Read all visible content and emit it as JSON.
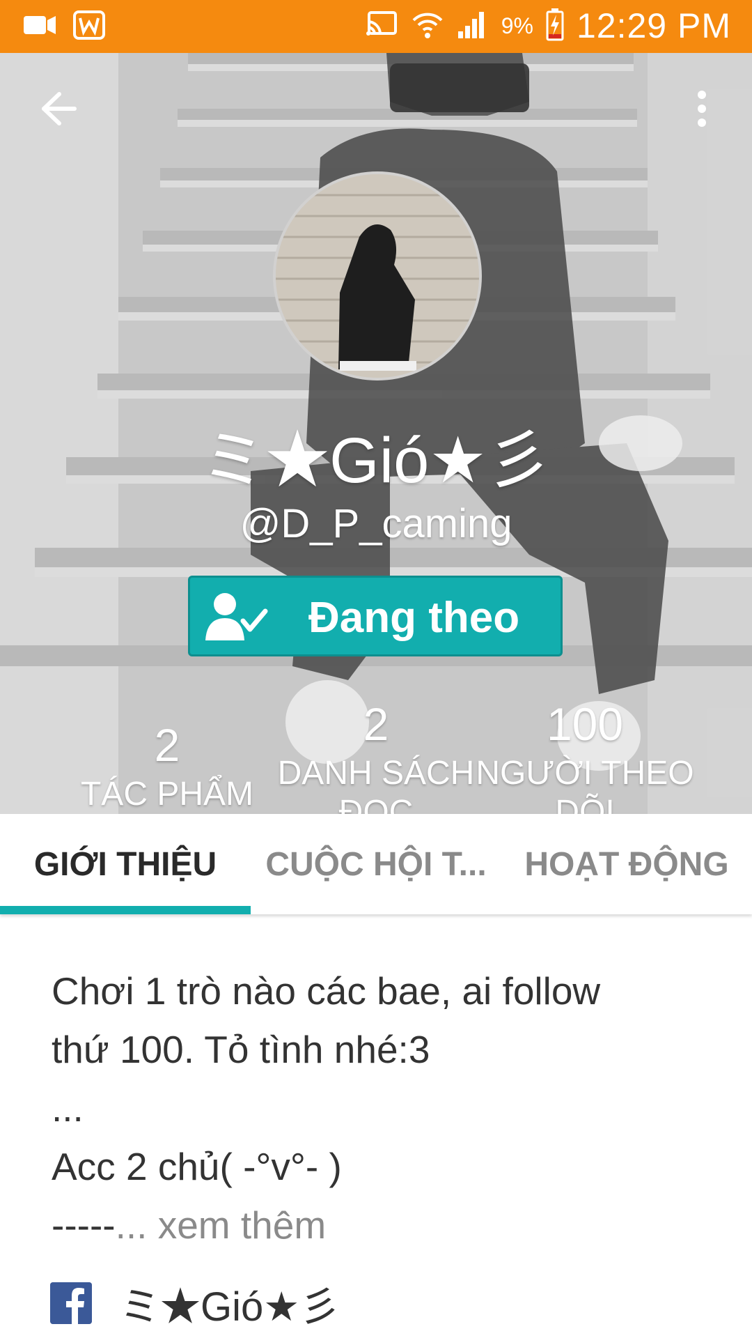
{
  "status_bar": {
    "battery_percent": "9%",
    "time": "12:29 PM",
    "bg_color": "#f58a0f",
    "icons": [
      "video-icon",
      "w-app-icon",
      "cast-icon",
      "wifi-icon",
      "signal-icon",
      "battery-charging-icon"
    ]
  },
  "header": {
    "back_icon": "arrow-left-icon",
    "menu_icon": "more-vertical-icon"
  },
  "profile": {
    "display_name": "ミ★Gió★彡",
    "username": "@D_P_caming",
    "follow_button_label": "Đang theo dõi",
    "follow_button_color": "#12aeae"
  },
  "stats": [
    {
      "value": "2",
      "label": "TÁC PHẨM"
    },
    {
      "value": "2",
      "label": "DANH SÁCH ĐỌC"
    },
    {
      "value": "100",
      "label": "NGƯỜI THEO DÕI"
    }
  ],
  "tabs": [
    {
      "label": "GIỚI THIỆU",
      "active": true
    },
    {
      "label": "CUỘC HỘI T...",
      "active": false
    },
    {
      "label": "HOẠT ĐỘNG",
      "active": false
    }
  ],
  "bio": {
    "text": "Chơi 1 trò nào các bae, ai follow\nthứ 100. Tỏ tình nhé:3\n...\nAcc 2 chủ( -°v°- )\n-----",
    "see_more": "... xem thêm"
  },
  "facebook": {
    "icon": "facebook-icon",
    "name": "ミ★Gió★彡"
  }
}
